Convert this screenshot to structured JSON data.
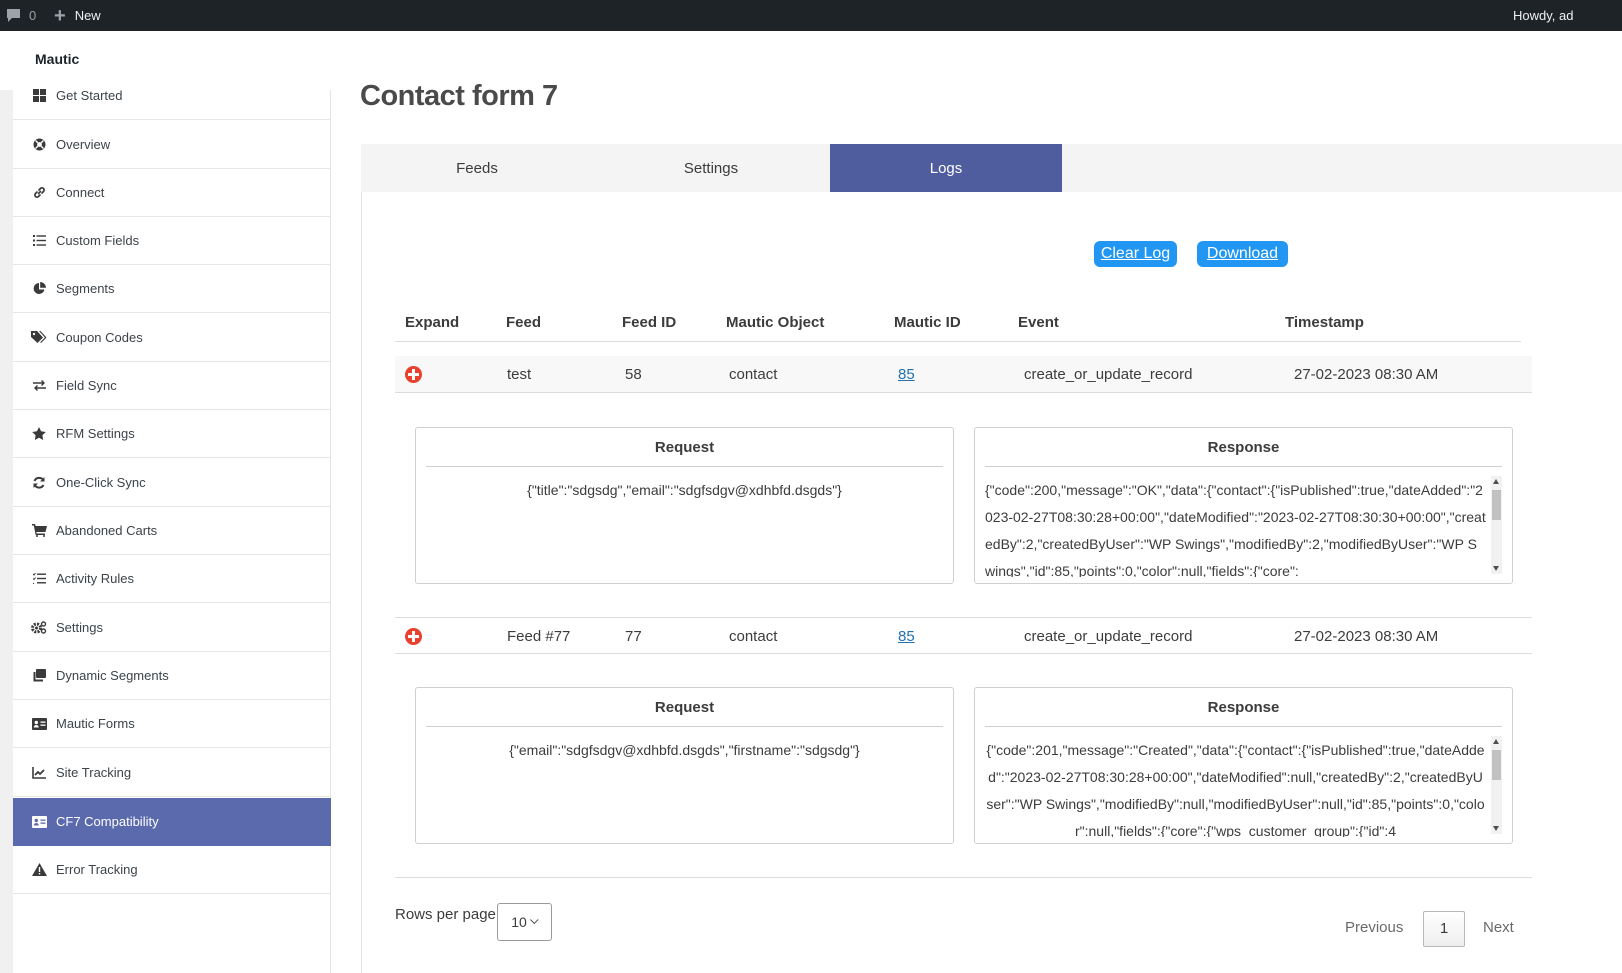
{
  "adminbar": {
    "comments_count": "0",
    "new_label": "New",
    "howdy": "Howdy, ad"
  },
  "brand": "Mautic",
  "sidebar": {
    "items": [
      {
        "label": "Get Started",
        "icon": "grid-icon"
      },
      {
        "label": "Overview",
        "icon": "life-ring-icon"
      },
      {
        "label": "Connect",
        "icon": "link-icon"
      },
      {
        "label": "Custom Fields",
        "icon": "list-icon"
      },
      {
        "label": "Segments",
        "icon": "pie-chart-icon"
      },
      {
        "label": "Coupon Codes",
        "icon": "tags-icon"
      },
      {
        "label": "Field Sync",
        "icon": "exchange-icon"
      },
      {
        "label": "RFM Settings",
        "icon": "star-icon"
      },
      {
        "label": "One-Click Sync",
        "icon": "sync-icon"
      },
      {
        "label": "Abandoned Carts",
        "icon": "cart-icon"
      },
      {
        "label": "Activity Rules",
        "icon": "checklist-icon"
      },
      {
        "label": "Settings",
        "icon": "gears-icon"
      },
      {
        "label": "Dynamic Segments",
        "icon": "clone-icon"
      },
      {
        "label": "Mautic Forms",
        "icon": "id-card-icon"
      },
      {
        "label": "Site Tracking",
        "icon": "line-chart-icon"
      },
      {
        "label": "CF7 Compatibility",
        "icon": "id-card-icon",
        "active": true
      },
      {
        "label": "Error Tracking",
        "icon": "warning-icon"
      }
    ]
  },
  "page": {
    "title": "Contact form 7",
    "tabs": [
      {
        "label": "Feeds"
      },
      {
        "label": "Settings"
      },
      {
        "label": "Logs",
        "active": true
      }
    ],
    "actions": {
      "clear_log": "Clear Log",
      "download": "Download"
    },
    "colors": {
      "accent": "#4f5d9f",
      "sidebar_active": "#5b6aad",
      "button_blue": "#2196f3",
      "expand_red": "#e8412d",
      "link": "#2271b1"
    }
  },
  "table": {
    "headers": [
      "Expand",
      "Feed",
      "Feed ID",
      "Mautic Object",
      "Mautic ID",
      "Event",
      "Timestamp"
    ],
    "rows": [
      {
        "feed": "test",
        "feed_id": "58",
        "object": "contact",
        "mautic_id": "85",
        "event": "create_or_update_record",
        "timestamp": "27-02-2023 08:30 AM",
        "request_title": "Request",
        "request": "{\"title\":\"sdgsdg\",\"email\":\"sdgfsdgv@xdhbfd.dsgds\"}",
        "response_title": "Response",
        "response": "{\"code\":200,\"message\":\"OK\",\"data\":{\"contact\":{\"isPublished\":true,\"dateAdded\":\"2023-02-27T08:30:28+00:00\",\"dateModified\":\"2023-02-27T08:30:30+00:00\",\"createdBy\":2,\"createdByUser\":\"WP Swings\",\"modifiedBy\":2,\"modifiedByUser\":\"WP Swings\",\"id\":85,\"points\":0,\"color\":null,\"fields\":{\"core\":"
      },
      {
        "feed": "Feed #77",
        "feed_id": "77",
        "object": "contact",
        "mautic_id": "85",
        "event": "create_or_update_record",
        "timestamp": "27-02-2023 08:30 AM",
        "request_title": "Request",
        "request": "{\"email\":\"sdgfsdgv@xdhbfd.dsgds\",\"firstname\":\"sdgsdg\"}",
        "response_title": "Response",
        "response": "{\"code\":201,\"message\":\"Created\",\"data\":{\"contact\":{\"isPublished\":true,\"dateAdded\":\"2023-02-27T08:30:28+00:00\",\"dateModified\":null,\"createdBy\":2,\"createdByUser\":\"WP Swings\",\"modifiedBy\":null,\"modifiedByUser\":null,\"id\":85,\"points\":0,\"color\":null,\"fields\":{\"core\":{\"wps_customer_group\":{\"id\":4"
      }
    ]
  },
  "pagination": {
    "rows_per_page_label": "Rows per page",
    "rows_per_page_value": "10",
    "previous": "Previous",
    "current_page": "1",
    "next": "Next"
  }
}
